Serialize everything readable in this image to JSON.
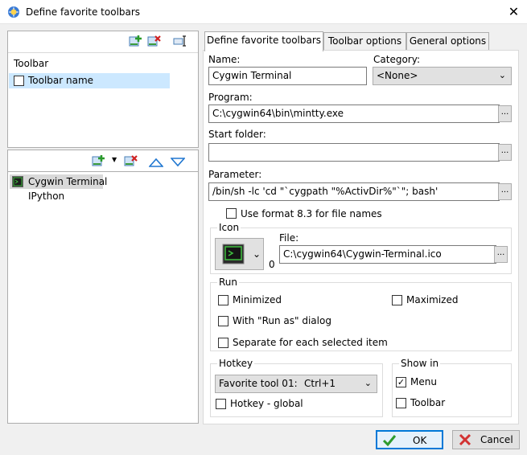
{
  "window": {
    "title": "Define favorite toolbars"
  },
  "toolbars_pane": {
    "header": "Toolbar",
    "items": [
      {
        "label": "Toolbar name",
        "checked": false
      }
    ]
  },
  "commands_pane": {
    "items": [
      {
        "label": "Cygwin Terminal",
        "icon": "terminal-icon",
        "selected": true
      },
      {
        "label": "IPython",
        "icon": "",
        "selected": false
      }
    ]
  },
  "tabs": [
    {
      "label": "Define favorite toolbars",
      "active": true
    },
    {
      "label": "Toolbar options",
      "active": false
    },
    {
      "label": "General options",
      "active": false
    }
  ],
  "form": {
    "name_label": "Name:",
    "name_value": "Cygwin Terminal",
    "category_label": "Category:",
    "category_value": "<None>",
    "program_label": "Program:",
    "program_value": "C:\\cygwin64\\bin\\mintty.exe",
    "start_folder_label": "Start folder:",
    "start_folder_value": "",
    "parameter_label": "Parameter:",
    "parameter_value": "/bin/sh -lc 'cd \"`cygpath \"%ActivDir%\"`\"; bash'",
    "format83_label": "Use format 8.3 for file names",
    "format83_checked": false,
    "browse_label": "..."
  },
  "icon_group": {
    "title": "Icon",
    "index": "0",
    "file_label": "File:",
    "file_value": "C:\\cygwin64\\Cygwin-Terminal.ico"
  },
  "run_group": {
    "title": "Run",
    "minimized": "Minimized",
    "maximized": "Maximized",
    "run_as": "With \"Run as\" dialog",
    "separate": "Separate for each selected item"
  },
  "hotkey_group": {
    "title": "Hotkey",
    "combo_tool": "Favorite tool 01:",
    "combo_key": "Ctrl+1",
    "global_label": "Hotkey - global"
  },
  "showin_group": {
    "title": "Show in",
    "menu_label": "Menu",
    "menu_checked": true,
    "toolbar_label": "Toolbar",
    "toolbar_checked": false
  },
  "buttons": {
    "ok": "OK",
    "cancel": "Cancel"
  },
  "colors": {
    "accent": "#0078d7",
    "selection": "#cce8ff",
    "ok_green": "#2e9b2e",
    "cancel_red": "#d23232"
  }
}
